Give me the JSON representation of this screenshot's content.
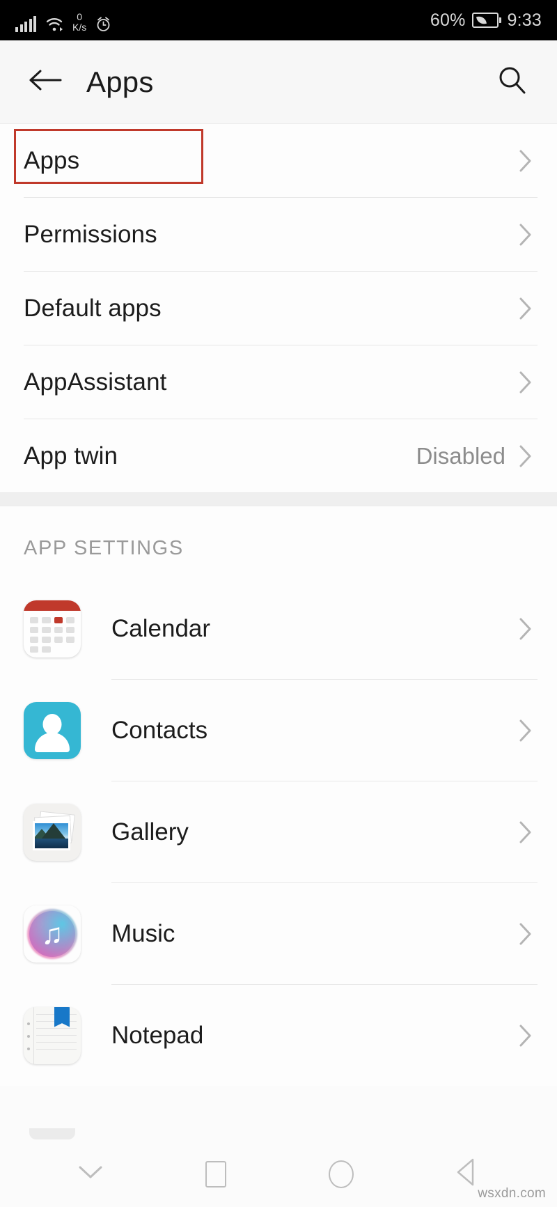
{
  "status_bar": {
    "network_speed_value": "0",
    "network_speed_unit": "K/s",
    "battery_percent": "60%",
    "clock": "9:33",
    "icons": [
      "signal-bars-icon",
      "wifi-icon",
      "alarm-clock-icon",
      "battery-saver-icon"
    ]
  },
  "app_bar": {
    "title": "Apps",
    "back_icon": "back-arrow-icon",
    "search_icon": "search-icon"
  },
  "highlight": {
    "target": "Apps",
    "color": "#c0392b"
  },
  "settings_list": [
    {
      "label": "Apps",
      "value": "",
      "chevron": "chevron-right-icon"
    },
    {
      "label": "Permissions",
      "value": "",
      "chevron": "chevron-right-icon"
    },
    {
      "label": "Default apps",
      "value": "",
      "chevron": "chevron-right-icon"
    },
    {
      "label": "AppAssistant",
      "value": "",
      "chevron": "chevron-right-icon"
    },
    {
      "label": "App twin",
      "value": "Disabled",
      "chevron": "chevron-right-icon"
    }
  ],
  "app_settings": {
    "header": "APP SETTINGS",
    "items": [
      {
        "label": "Calendar",
        "icon": "calendar-app-icon",
        "chevron": "chevron-right-icon"
      },
      {
        "label": "Contacts",
        "icon": "contacts-app-icon",
        "chevron": "chevron-right-icon"
      },
      {
        "label": "Gallery",
        "icon": "gallery-app-icon",
        "chevron": "chevron-right-icon"
      },
      {
        "label": "Music",
        "icon": "music-app-icon",
        "chevron": "chevron-right-icon"
      },
      {
        "label": "Notepad",
        "icon": "notepad-app-icon",
        "chevron": "chevron-right-icon"
      }
    ]
  },
  "nav_bar": {
    "buttons": [
      "hide-keyboard-chevron-icon",
      "recents-square-icon",
      "home-circle-icon",
      "back-triangle-icon"
    ]
  },
  "watermark": "wsxdn.com"
}
